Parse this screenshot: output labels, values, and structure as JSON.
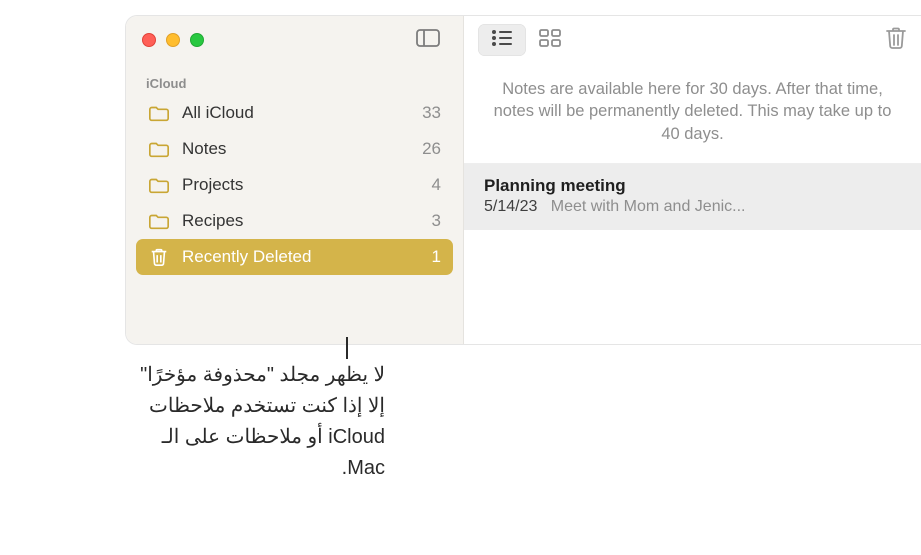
{
  "sidebar": {
    "section": "iCloud",
    "items": [
      {
        "label": "All iCloud",
        "count": "33",
        "selected": false,
        "icon": "folder"
      },
      {
        "label": "Notes",
        "count": "26",
        "selected": false,
        "icon": "folder"
      },
      {
        "label": "Projects",
        "count": "4",
        "selected": false,
        "icon": "folder"
      },
      {
        "label": "Recipes",
        "count": "3",
        "selected": false,
        "icon": "folder"
      },
      {
        "label": "Recently Deleted",
        "count": "1",
        "selected": true,
        "icon": "trash"
      }
    ]
  },
  "notice": "Notes are available here for 30 days. After that time, notes will be permanently deleted. This may take up to 40 days.",
  "notes": [
    {
      "title": "Planning meeting",
      "date": "5/14/23",
      "preview": "Meet with Mom and Jenic..."
    }
  ],
  "callout": "لا يظهر مجلد \"محذوفة مؤخرًا\" إلا إذا كنت تستخدم ملاحظات iCloud أو ملاحظات على الـ Mac."
}
